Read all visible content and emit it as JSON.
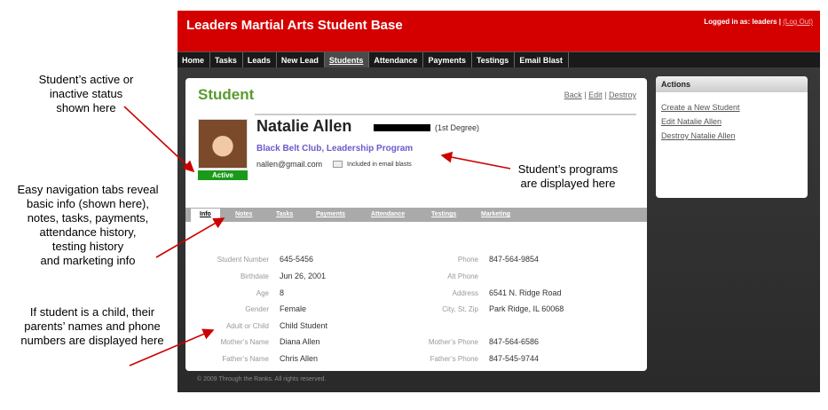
{
  "annotations": {
    "status_note": "Student’s  active or\ninactive status\nshown here",
    "tabs_note": "Easy navigation tabs reveal\nbasic info (shown here),\nnotes, tasks, payments,\nattendance history,\ntesting history\nand marketing info",
    "parents_note": "If student is a child, their\nparents’ names and phone\nnumbers are displayed here",
    "programs_note": "Student’s programs\nare displayed here"
  },
  "header": {
    "title": "Leaders Martial Arts Student Base",
    "login_text": "Logged in as: leaders |",
    "logout_label": "(Log Out)"
  },
  "nav": {
    "items": [
      "Home",
      "Tasks",
      "Leads",
      "New Lead",
      "Students",
      "Attendance",
      "Payments",
      "Testings",
      "Email Blast"
    ],
    "active": "Students"
  },
  "student": {
    "page_title": "Student",
    "links": {
      "back": "Back",
      "edit": "Edit",
      "destroy": "Destroy",
      "sep": "|"
    },
    "name": "Natalie Allen",
    "degree": "(1st Degree)",
    "programs": "Black Belt Club, Leadership Program",
    "email": "nallen@gmail.com",
    "email_note": "Included in email blasts",
    "status": "Active"
  },
  "tabs": [
    "Info",
    "Notes",
    "Tasks",
    "Payments",
    "Attendance",
    "Testings",
    "Marketing"
  ],
  "info": {
    "left": [
      {
        "label": "Student Number",
        "value": "645-5456"
      },
      {
        "label": "Birthdate",
        "value": "Jun 26, 2001"
      },
      {
        "label": "Age",
        "value": "8"
      },
      {
        "label": "Gender",
        "value": "Female"
      },
      {
        "label": "Adult or Child",
        "value": "Child Student"
      },
      {
        "label": "Mother’s Name",
        "value": "Diana Allen"
      },
      {
        "label": "Father’s Name",
        "value": "Chris Allen"
      }
    ],
    "right": [
      {
        "label": "Phone",
        "value": "847-564-9854"
      },
      {
        "label": "Alt Phone",
        "value": ""
      },
      {
        "label": "Address",
        "value": "6541 N. Ridge Road"
      },
      {
        "label": "City, St, Zip",
        "value": "Park Ridge, IL 60068"
      },
      {
        "label": "",
        "value": ""
      },
      {
        "label": "Mother’s Phone",
        "value": "847-564-6586"
      },
      {
        "label": "Father’s Phone",
        "value": "847-545-9744"
      }
    ]
  },
  "actions": {
    "title": "Actions",
    "items": [
      "Create a New Student",
      "Edit Natalie Allen",
      "Destroy Natalie Allen"
    ]
  },
  "footer": {
    "copyright": "© 2009 Through the Ranks. All rights reserved."
  },
  "colors": {
    "header_red": "#d40000",
    "title_green": "#5a9a2e",
    "status_green": "#1a9a1a",
    "program_purple": "#6a5acd",
    "arrow_red": "#cc0000"
  }
}
